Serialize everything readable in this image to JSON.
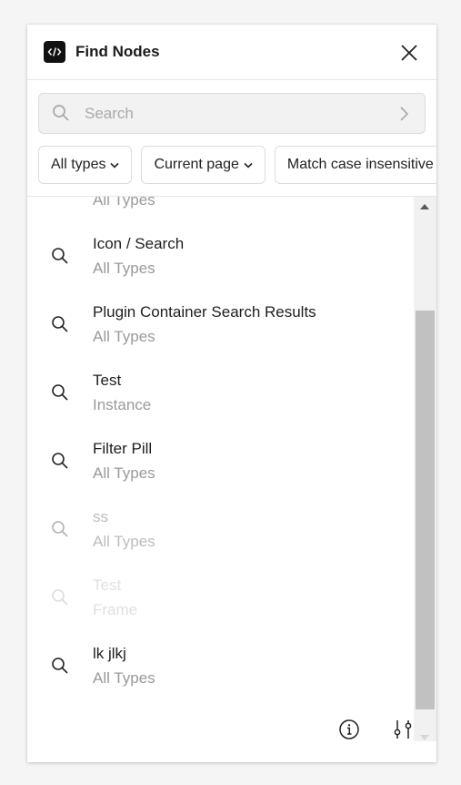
{
  "app": {
    "title": "Find Nodes",
    "logo_icon": "code-brackets-icon"
  },
  "search": {
    "placeholder": "Search",
    "value": ""
  },
  "filters": [
    {
      "label": "All types"
    },
    {
      "label": "Current page"
    },
    {
      "label": "Match case insensitive"
    }
  ],
  "results": [
    {
      "name": "",
      "type": "All Types"
    },
    {
      "name": "Icon / Search",
      "type": "All Types"
    },
    {
      "name": "Plugin Container Search Results",
      "type": "All Types"
    },
    {
      "name": "Test",
      "type": "Instance"
    },
    {
      "name": "Filter Pill",
      "type": "All Types"
    },
    {
      "name": "ss",
      "type": "All Types"
    },
    {
      "name": "Test",
      "type": "Frame"
    },
    {
      "name": "lk jlkj",
      "type": "All Types"
    }
  ],
  "colors": {
    "accent": "#111111",
    "muted_text": "#9a9a9a",
    "scrollbar_thumb": "#c1c1c1"
  }
}
